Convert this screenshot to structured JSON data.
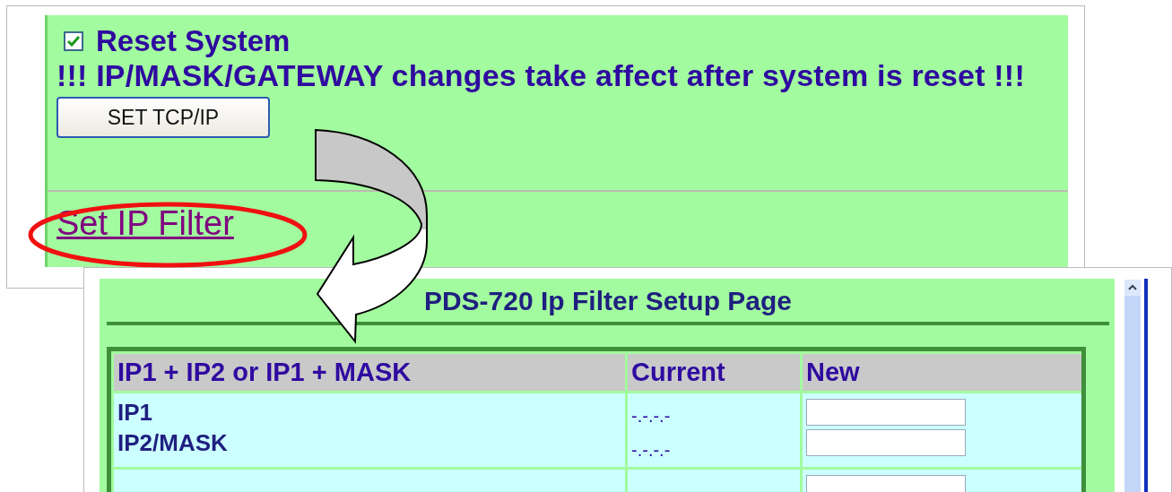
{
  "reset_panel": {
    "reset_checkbox": {
      "label": "Reset System",
      "checked": true
    },
    "notice": "!!! IP/MASK/GATEWAY changes take affect after system is reset !!!",
    "set_button": "SET TCP/IP",
    "link": "Set IP Filter"
  },
  "filter_page": {
    "title": "PDS-720 Ip Filter Setup Page",
    "table": {
      "columns": [
        "IP1 + IP2 or IP1 + MASK",
        "Current",
        "New"
      ],
      "rows": [
        {
          "labels": [
            "IP1",
            "IP2/MASK"
          ],
          "current": [
            "-.-.-.-",
            "-.-.-.-"
          ]
        }
      ]
    }
  }
}
